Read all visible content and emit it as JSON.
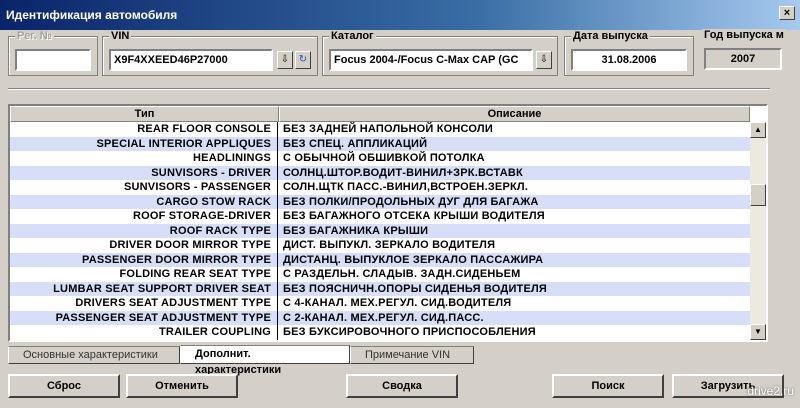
{
  "window": {
    "title": "Идентификация автомобиля",
    "close": "×"
  },
  "fields": {
    "reg": {
      "label": "Рег. №",
      "value": ""
    },
    "vin": {
      "label": "VIN",
      "value": "X9F4XXEED46P27000"
    },
    "catalog": {
      "label": "Каталог",
      "value": "Focus 2004-/Focus C-Max CAP (GC"
    },
    "date": {
      "label": "Дата выпуска",
      "value": "31.08.2006"
    },
    "year": {
      "label": "Год выпуска м",
      "value": "2007"
    }
  },
  "table": {
    "headers": [
      "Тип",
      "Описание"
    ],
    "rows": [
      [
        "REAR FLOOR CONSOLE",
        "БЕЗ ЗАДНЕЙ НАПОЛЬНОЙ КОНСОЛИ"
      ],
      [
        "SPECIAL INTERIOR APPLIQUES",
        "БЕЗ СПЕЦ. АППЛИКАЦИЙ"
      ],
      [
        "HEADLININGS",
        "С ОБЫЧНОЙ ОБШИВКОЙ ПОТОЛКА"
      ],
      [
        "SUNVISORS - DRIVER",
        "СОЛНЦ.ШТОР.ВОДИТ-ВИНИЛ+ЗРК.ВСТАВК"
      ],
      [
        "SUNVISORS - PASSENGER",
        "СОЛН.ЩТК ПАСС.-ВИНИЛ,ВСТРОЕН.ЗЕРКЛ."
      ],
      [
        "CARGO STOW RACK",
        "БЕЗ ПОЛКИ/ПРОДОЛЬНЫХ ДУГ ДЛЯ БАГАЖА"
      ],
      [
        "ROOF STORAGE-DRIVER",
        "БЕЗ БАГАЖНОГО ОТСЕКА КРЫШИ ВОДИТЕЛЯ"
      ],
      [
        "ROOF RACK TYPE",
        "БЕЗ БАГАЖНИКА КРЫШИ"
      ],
      [
        "DRIVER DOOR MIRROR TYPE",
        "ДИСТ. ВЫПУКЛ. ЗЕРКАЛО ВОДИТЕЛЯ"
      ],
      [
        "PASSENGER DOOR MIRROR TYPE",
        "ДИСТАНЦ. ВЫПУКЛОЕ ЗЕРКАЛО ПАССАЖИРА"
      ],
      [
        "FOLDING REAR SEAT TYPE",
        "С РАЗДЕЛЬН. СЛАДЫВ. ЗАДН.СИДЕНЬЕМ"
      ],
      [
        "LUMBAR SEAT SUPPORT DRIVER SEAT",
        "БЕЗ ПОЯСНИЧН.ОПОРЫ СИДЕНЬЯ ВОДИТЕЛЯ"
      ],
      [
        "DRIVERS SEAT ADJUSTMENT TYPE",
        "С 4-КАНАЛ. МЕХ.РЕГУЛ. СИД.ВОДИТЕЛЯ"
      ],
      [
        "PASSENGER SEAT ADJUSTMENT TYPE",
        "С 2-КАНАЛ. МЕХ.РЕГУЛ. СИД.ПАСС."
      ],
      [
        "TRAILER COUPLING",
        "БЕЗ БУКСИРОВОЧНОГО ПРИСПОСОБЛЕНИЯ"
      ]
    ]
  },
  "tabs": [
    "Основные характеристики",
    "Дополнит. характеристики",
    "Примечание VIN"
  ],
  "buttons": {
    "reset": "Сброс",
    "cancel": "Отменить",
    "summary": "Сводка",
    "search": "Поиск",
    "load": "Загрузить"
  },
  "watermark": "drive2.ru"
}
